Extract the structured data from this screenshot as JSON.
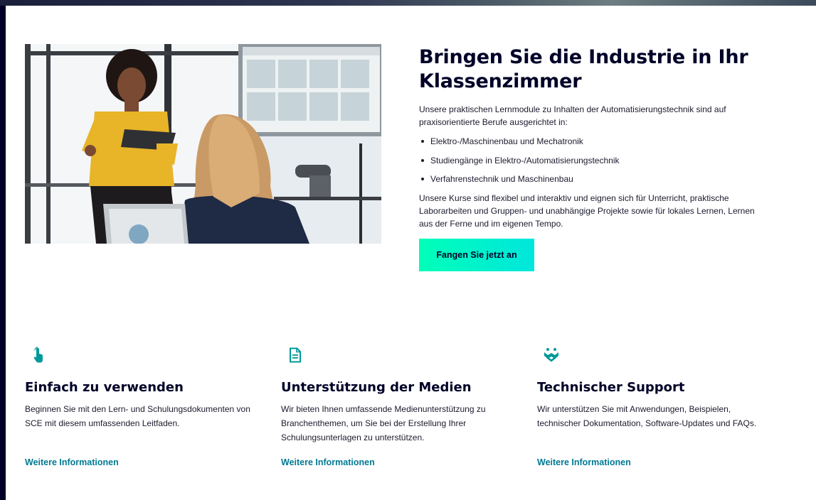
{
  "hero": {
    "title": "Bringen Sie die Industrie in Ihr Klassenzimmer",
    "intro": "Unsere praktischen Lernmodule zu Inhalten der Automatisierungstechnik sind auf praxisorientierte Berufe ausgerichtet in:",
    "bullets": [
      "Elektro-/Maschinenbau und Mechatronik",
      "Studiengänge in Elektro-/Automatisierungstechnik",
      "Verfahrenstechnik und Maschinenbau"
    ],
    "outro": "Unsere Kurse sind flexibel und interaktiv und eignen sich für Unterricht, praktische Laborarbeiten und Gruppen- und unabhängige Projekte sowie für lokales Lernen, Lernen aus der Ferne und im eigenen Tempo.",
    "cta_label": "Fangen Sie jetzt an",
    "image_icon": "classroom-photo"
  },
  "features": [
    {
      "icon": "touch-hand-icon",
      "title": "Einfach zu verwenden",
      "description": "Beginnen Sie mit den Lern- und Schulungsdokumenten von SCE mit diesem umfassenden Leitfaden.",
      "link": "Weitere Informationen"
    },
    {
      "icon": "document-icon",
      "title": "Unterstützung der Medien",
      "description": "Wir bieten Ihnen umfassende Medienunterstützung zu Branchenthemen, um Sie bei der Erstellung Ihrer Schulungsunterlagen zu unterstützen.",
      "link": "Weitere Informationen"
    },
    {
      "icon": "support-hands-icon",
      "title": "Technischer Support",
      "description": "Wir unterstützen Sie mit Anwendungen, Beispielen, technischer Dokumentation, Software-Updates und FAQs.",
      "link": "Weitere Informationen"
    }
  ],
  "colors": {
    "background": "#000028",
    "accent_gradient_start": "#00ffb9",
    "accent_gradient_end": "#00e6dc",
    "link": "#007993",
    "icon": "#009999"
  }
}
